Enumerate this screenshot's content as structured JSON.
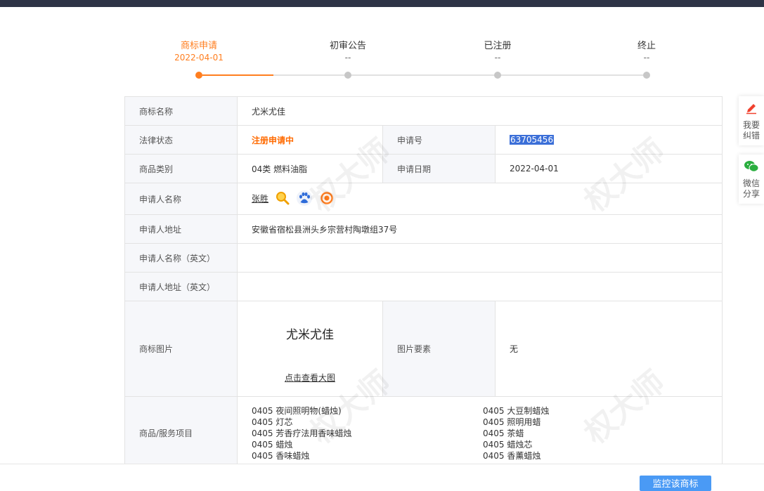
{
  "progress": {
    "steps": [
      {
        "title": "商标申请",
        "sub": "2022-04-01",
        "active": true
      },
      {
        "title": "初审公告",
        "sub": "--",
        "active": false
      },
      {
        "title": "已注册",
        "sub": "--",
        "active": false
      },
      {
        "title": "终止",
        "sub": "--",
        "active": false
      }
    ]
  },
  "table": {
    "labels": {
      "name": "商标名称",
      "status": "法律状态",
      "app_no": "申请号",
      "category": "商品类别",
      "app_date": "申请日期",
      "applicant": "申请人名称",
      "address": "申请人地址",
      "applicant_en": "申请人名称（英文）",
      "address_en": "申请人地址（英文）",
      "image": "商标图片",
      "image_elements": "图片要素",
      "services": "商品/服务项目"
    },
    "values": {
      "name": "尤米尤佳",
      "status": "注册申请中",
      "app_no": "63705456",
      "category": "04类 燃料油脂",
      "app_date": "2022-04-01",
      "applicant": "张胜",
      "address": "安徽省宿松县洲头乡宗营村陶墩组37号",
      "applicant_en": "",
      "address_en": "",
      "trademark_text": "尤米尤佳",
      "view_large": "点击查看大图",
      "image_elements": "无"
    },
    "services_left": [
      "0405 夜间照明物(蜡烛)",
      "0405 灯芯",
      "0405 芳香疗法用香味蜡烛",
      "0405 蜡烛",
      "0405 香味蜡烛"
    ],
    "services_right": [
      "0405 大豆制蜡烛",
      "0405 照明用蜡",
      "0405 茶蜡",
      "0405 蜡烛芯",
      "0405 香薰蜡烛"
    ]
  },
  "float_bar": {
    "report": "我要纠错",
    "share": "微信分享"
  },
  "watermark": "权大师",
  "monitor_button": "监控该商标",
  "icons": {
    "search": "magnifier-icon",
    "baidu": "baidu-paw-icon",
    "target": "target-icon",
    "edit": "pencil-icon",
    "wechat": "wechat-icon"
  },
  "colors": {
    "accent": "#ff7e1f",
    "status": "#ff6a00",
    "label_bg": "#f6f7fa",
    "topbar": "#2e3446",
    "button": "#4a9af5"
  }
}
